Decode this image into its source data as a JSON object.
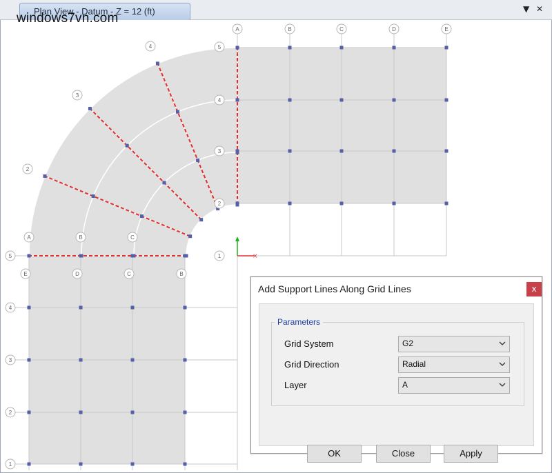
{
  "window": {
    "tab_title": "Plan View - Datum - Z = 12 (ft)",
    "watermark": "windows7vn.com",
    "menu_arrow": "▼",
    "close_glyph": "✕"
  },
  "plan": {
    "top_grid_labels": [
      "A",
      "B",
      "C",
      "D",
      "E"
    ],
    "right_row_labels": [
      "5",
      "4",
      "3",
      "2"
    ],
    "radial_labels": [
      "4",
      "3",
      "2"
    ],
    "arc_labels": [
      "A",
      "B",
      "C"
    ],
    "left_row_labels": [
      "5",
      "4",
      "3",
      "2",
      "1"
    ],
    "bottom_labels": [
      "E",
      "D",
      "C",
      "B"
    ],
    "center_label": "1",
    "colors": {
      "slab": "#e0e0e0",
      "grid_line": "#c8c8c8",
      "support_line": "#e03030",
      "node": "#5560a8",
      "axis_x": "#e03030",
      "axis_y": "#20b020"
    }
  },
  "dialog": {
    "title": "Add Support Lines Along Grid Lines",
    "close_label": "x",
    "group_label": "Parameters",
    "fields": [
      {
        "label": "Grid System",
        "value": "G2"
      },
      {
        "label": "Grid Direction",
        "value": "Radial"
      },
      {
        "label": "Layer",
        "value": "A"
      }
    ],
    "buttons": {
      "ok": "OK",
      "close": "Close",
      "apply": "Apply"
    }
  }
}
